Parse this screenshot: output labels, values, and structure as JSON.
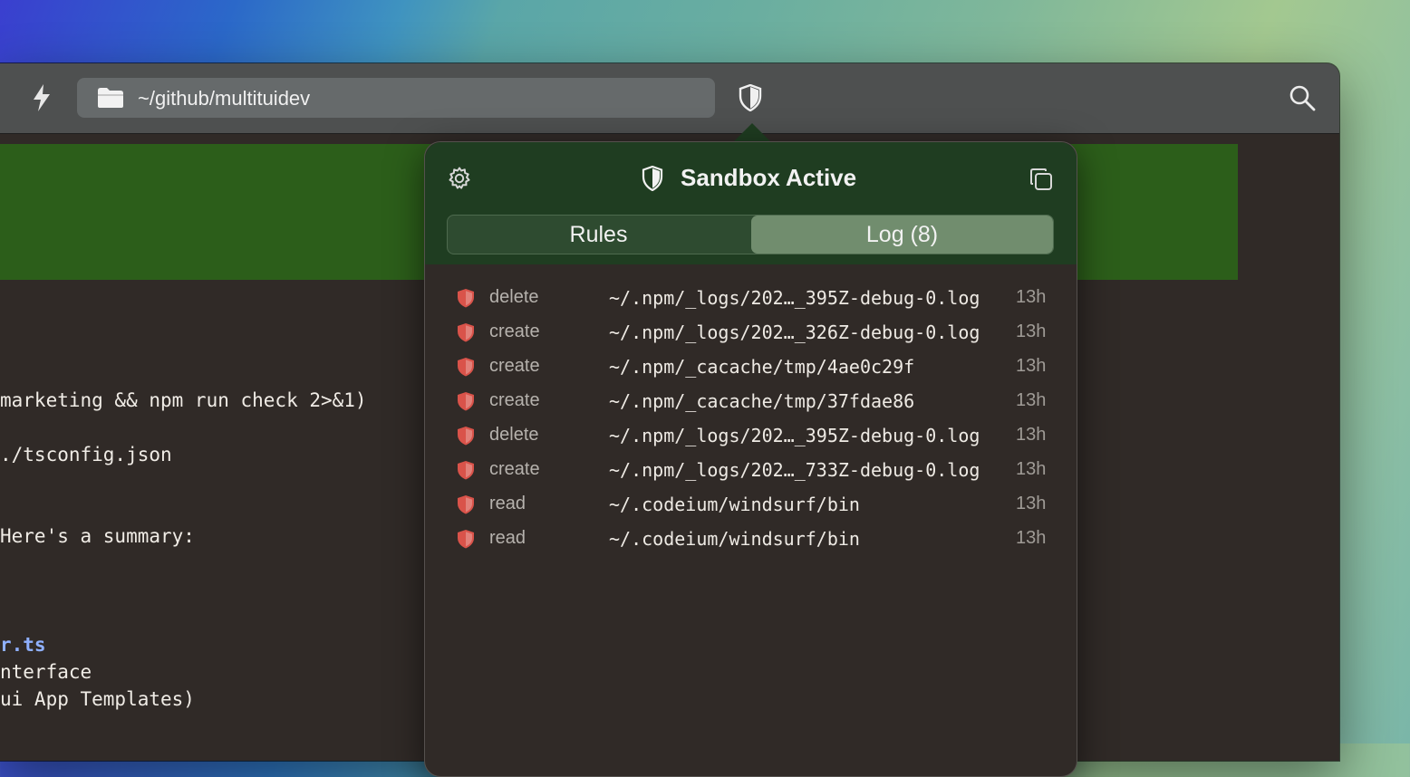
{
  "toolbar": {
    "path": "~/github/multituidev",
    "icons": [
      "bolt-icon",
      "folder-icon",
      "shield-icon",
      "search-icon"
    ]
  },
  "terminal": {
    "lines": [
      "marketing && npm run check 2>&1)",
      "./tsconfig.json",
      "Here's a summary:",
      "r.ts",
      "nterface",
      "ui App Templates)"
    ]
  },
  "popover": {
    "title": "Sandbox Active",
    "tabs": {
      "rules": "Rules",
      "log": "Log (8)"
    },
    "selected_tab": "log",
    "log": [
      {
        "action": "delete",
        "path": "~/.npm/_logs/202…_395Z-debug-0.log",
        "time": "13h"
      },
      {
        "action": "create",
        "path": "~/.npm/_logs/202…_326Z-debug-0.log",
        "time": "13h"
      },
      {
        "action": "create",
        "path": "~/.npm/_cacache/tmp/4ae0c29f",
        "time": "13h"
      },
      {
        "action": "create",
        "path": "~/.npm/_cacache/tmp/37fdae86",
        "time": "13h"
      },
      {
        "action": "delete",
        "path": "~/.npm/_logs/202…_395Z-debug-0.log",
        "time": "13h"
      },
      {
        "action": "create",
        "path": "~/.npm/_logs/202…_733Z-debug-0.log",
        "time": "13h"
      },
      {
        "action": "read",
        "path": "~/.codeium/windsurf/bin",
        "time": "13h"
      },
      {
        "action": "read",
        "path": "~/.codeium/windsurf/bin",
        "time": "13h"
      }
    ]
  },
  "colors": {
    "banner_green": "#2c5e1a",
    "popover_header": "#1f3d21",
    "selected_segment": "#718d6e",
    "shield_red": "#d9534a"
  }
}
